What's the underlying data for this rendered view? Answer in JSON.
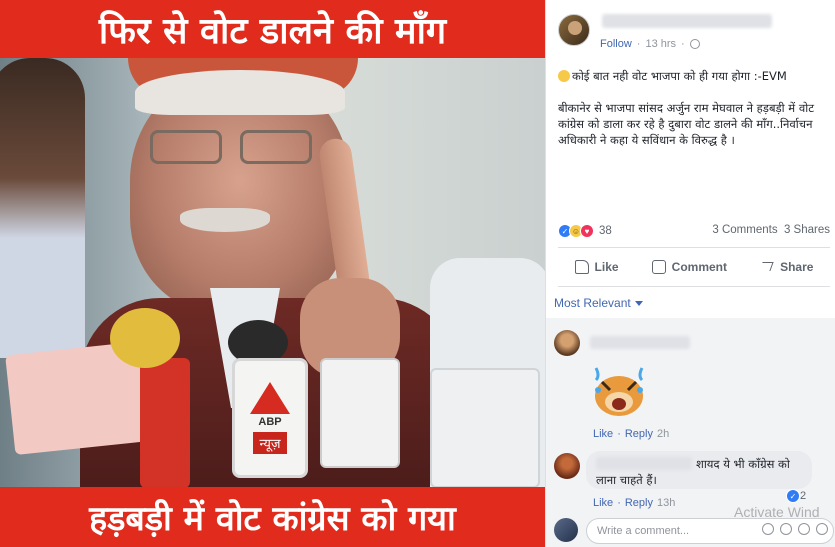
{
  "image": {
    "headline_top": "फिर से वोट डालने की माँग",
    "headline_bottom": "हड़बड़ी में वोट कांग्रेस को गया",
    "mic_brand": "ABP",
    "mic_brand_sub": "न्यूज़"
  },
  "post": {
    "follow_label": "Follow",
    "time": "13 hrs",
    "line1": "कोई बात नही वोट भाजपा को ही गया होगा :-EVM",
    "line2": "बीकानेर से भाजपा सांसद अर्जुन राम मेघवाल ने हड़बड़ी में वोट कांग्रेस को डाला कर रहे है दुबारा वोट डालने की माँग..निर्वाचन अधिकारी ने कहा ये सविंधान के विरुद्ध है ।",
    "reaction_count": "38",
    "comments_count": "3 Comments",
    "shares_count": "3 Shares"
  },
  "actions": {
    "like": "Like",
    "comment": "Comment",
    "share": "Share"
  },
  "comments": {
    "sort_label": "Most Relevant",
    "c1": {
      "like": "Like",
      "reply": "Reply",
      "time": "2h"
    },
    "c2": {
      "text": "शायद ये भी कॉंग्रेस को लाना चाहते हैं।",
      "like": "Like",
      "reply": "Reply",
      "time": "13h",
      "like_count": "2"
    },
    "write_placeholder": "Write a comment..."
  },
  "system": {
    "watermark": "Activate Wind"
  }
}
